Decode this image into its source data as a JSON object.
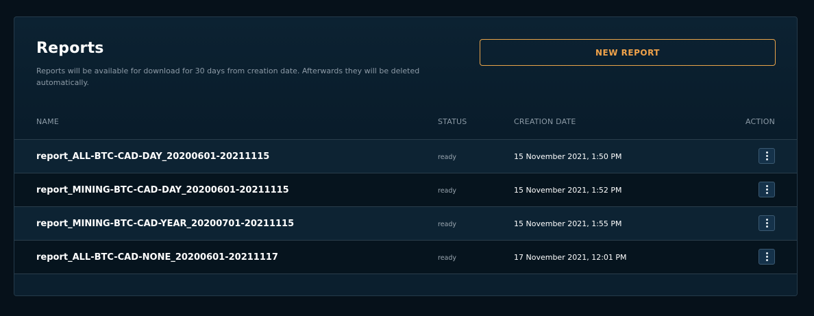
{
  "header": {
    "title": "Reports",
    "subtitle": "Reports will be available for download for 30 days from creation date. Afterwards they will be deleted automatically.",
    "new_report_label": "NEW REPORT"
  },
  "table": {
    "columns": {
      "name": "NAME",
      "status": "STATUS",
      "creation_date": "CREATION DATE",
      "action": "ACTION"
    },
    "rows": [
      {
        "name": "report_ALL-BTC-CAD-DAY_20200601-20211115",
        "status": "ready",
        "creation_date": "15 November 2021, 1:50 PM",
        "action_icon": "more-vertical-icon"
      },
      {
        "name": "report_MINING-BTC-CAD-DAY_20200601-20211115",
        "status": "ready",
        "creation_date": "15 November 2021, 1:52 PM",
        "action_icon": "more-vertical-icon"
      },
      {
        "name": "report_MINING-BTC-CAD-YEAR_20200701-20211115",
        "status": "ready",
        "creation_date": "15 November 2021, 1:55 PM",
        "action_icon": "more-vertical-icon"
      },
      {
        "name": "report_ALL-BTC-CAD-NONE_20200601-20211117",
        "status": "ready",
        "creation_date": "17 November 2021, 12:01 PM",
        "action_icon": "more-vertical-icon"
      }
    ]
  },
  "colors": {
    "background": "#06111a",
    "card": "#0c2232",
    "accent": "#f0a24a",
    "text": "#ffffff",
    "muted": "#8c9aa6"
  }
}
